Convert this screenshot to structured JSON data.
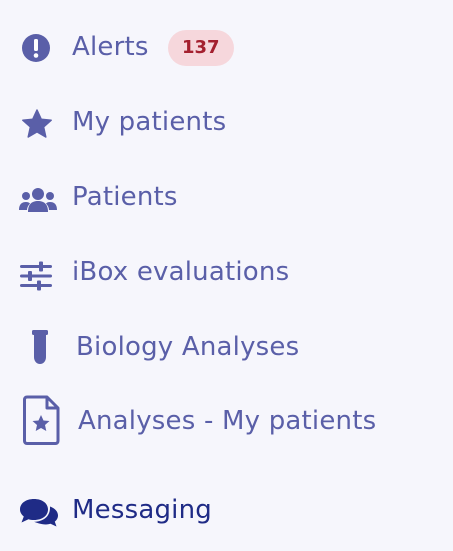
{
  "colors": {
    "background": "#f6f6fc",
    "item_text": "#5a5fa8",
    "active_text": "#1f2b86",
    "badge_bg": "#f6d7dc",
    "badge_text": "#a4202f"
  },
  "menu": {
    "items": [
      {
        "label": "Alerts",
        "icon": "exclamation-circle-icon",
        "badge": "137"
      },
      {
        "label": "My patients",
        "icon": "star-icon"
      },
      {
        "label": "Patients",
        "icon": "users-icon"
      },
      {
        "label": "iBox evaluations",
        "icon": "sliders-icon"
      },
      {
        "label": "Biology Analyses",
        "icon": "test-tube-icon"
      },
      {
        "label": "Analyses - My patients",
        "icon": "file-star-icon"
      },
      {
        "label": "Messaging",
        "icon": "comments-icon"
      }
    ]
  }
}
